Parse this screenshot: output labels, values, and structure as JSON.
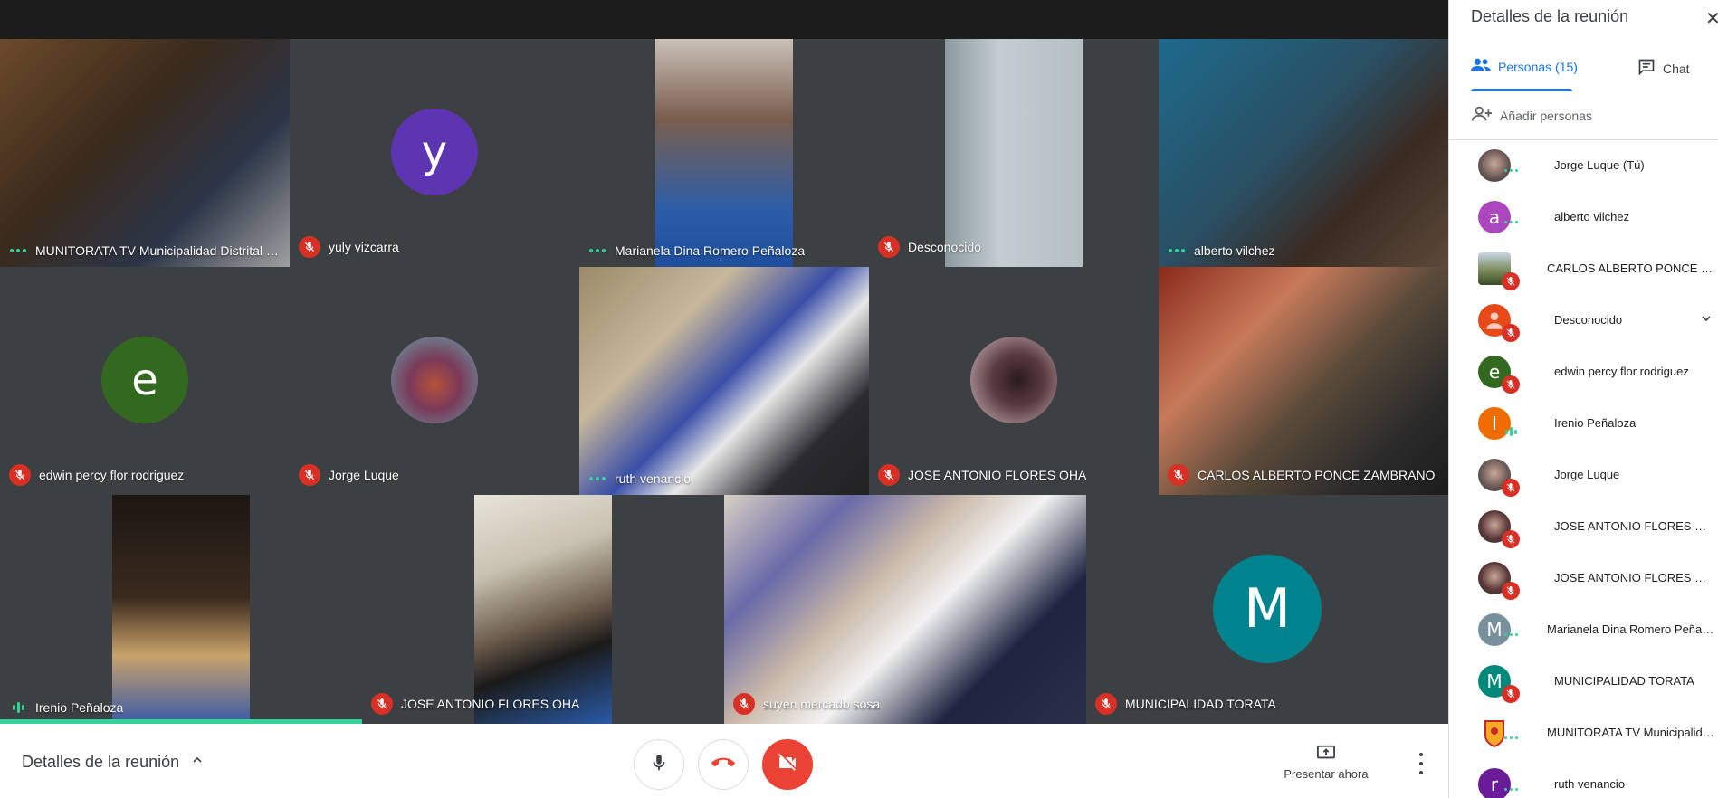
{
  "grid": {
    "tiles": [
      {
        "name": "MUNITORATA TV Municipalidad Distrital d...",
        "status": "speaking-dots"
      },
      {
        "name": "yuly vizcarra",
        "status": "muted",
        "avatar_letter": "y",
        "avatar_color": "#5e35b1"
      },
      {
        "name": "Marianela Dina Romero Peñaloza",
        "status": "speaking-dots"
      },
      {
        "name": "Desconocido",
        "status": "muted"
      },
      {
        "name": "alberto vilchez",
        "status": "speaking-dots"
      },
      {
        "name": "edwin percy flor rodriguez",
        "status": "muted",
        "avatar_letter": "e",
        "avatar_color": "#33691e"
      },
      {
        "name": "Jorge Luque",
        "status": "muted"
      },
      {
        "name": "ruth venancio",
        "status": "speaking-dots"
      },
      {
        "name": "JOSE ANTONIO FLORES OHA",
        "status": "muted"
      },
      {
        "name": "CARLOS ALBERTO PONCE ZAMBRANO",
        "status": "muted"
      },
      {
        "name": "Irenio Peñaloza",
        "status": "speaking"
      },
      {
        "name": "JOSE ANTONIO FLORES OHA",
        "status": "muted"
      },
      {
        "name": "suyen mercado sosa",
        "status": "muted"
      },
      {
        "name": "MUNICIPALIDAD TORATA",
        "status": "muted",
        "avatar_letter": "M",
        "avatar_color": "#00838f"
      }
    ]
  },
  "bottombar": {
    "details_label": "Detalles de la reunión",
    "present_label": "Presentar ahora"
  },
  "panel": {
    "title": "Detalles de la reunión",
    "tab_people": "Personas (15)",
    "tab_chat": "Chat",
    "add_people": "Añadir personas",
    "participants": [
      {
        "name": "Jorge Luque (Tú)",
        "status": "dots",
        "avatar": "photo",
        "color": "#6d5b58"
      },
      {
        "name": "alberto vilchez",
        "status": "dots",
        "avatar_letter": "a",
        "color": "#ab47bc"
      },
      {
        "name": "CARLOS ALBERTO PONCE ZA...",
        "status": "muted",
        "avatar": "photo-square",
        "color": "#7a8a5a"
      },
      {
        "name": "Desconocido",
        "status": "muted",
        "avatar": "person",
        "color": "#e64a19",
        "expandable": true
      },
      {
        "name": "edwin percy flor rodriguez",
        "status": "muted",
        "avatar_letter": "e",
        "color": "#33691e"
      },
      {
        "name": "Irenio Peñaloza",
        "status": "speaking",
        "avatar_letter": "I",
        "color": "#ef6c00"
      },
      {
        "name": "Jorge Luque",
        "status": "muted",
        "avatar": "photo",
        "color": "#6d5b58"
      },
      {
        "name": "JOSE ANTONIO FLORES OHA",
        "status": "muted",
        "avatar": "photo",
        "color": "#5d3a3a"
      },
      {
        "name": "JOSE ANTONIO FLORES OHA",
        "status": "muted",
        "avatar": "photo",
        "color": "#5d3a3a"
      },
      {
        "name": "Marianela Dina Romero Peñalo...",
        "status": "dots",
        "avatar_letter": "M",
        "color": "#78909c"
      },
      {
        "name": "MUNICIPALIDAD TORATA",
        "status": "muted",
        "avatar_letter": "M",
        "color": "#00897b"
      },
      {
        "name": "MUNITORATA TV Municipalida...",
        "status": "dots",
        "avatar": "logo",
        "color": "#f9a825"
      },
      {
        "name": "ruth venancio",
        "status": "dots",
        "avatar_letter": "r",
        "color": "#6a1b9a"
      }
    ]
  },
  "colors": {
    "accent": "#1a73e8",
    "muted": "#d93025",
    "end_call": "#ea4335",
    "speaking": "#34d399"
  }
}
